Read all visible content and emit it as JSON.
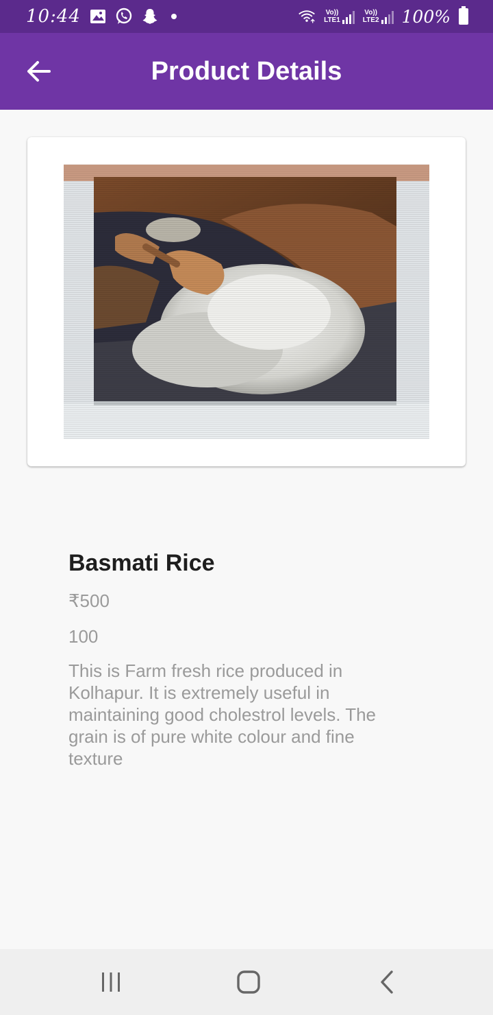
{
  "status_bar": {
    "time": "10:44",
    "sim1_top": "Vo))",
    "sim1_label": "LTE1",
    "sim2_top": "Vo))",
    "sim2_label": "LTE2",
    "battery": "100%",
    "icons": [
      "gallery-icon",
      "whatsapp-icon",
      "snapchat-icon",
      "notification-dot",
      "wifi-icon",
      "signal-icon",
      "battery-icon"
    ]
  },
  "app_bar": {
    "title": "Product Details",
    "back_icon": "arrow-left-icon"
  },
  "product": {
    "image_description_icon": "product-image",
    "name": "Basmati Rice",
    "price": "₹500",
    "quantity": "100",
    "description": "This is Farm fresh rice produced in Kolhapur. It is extremely useful in maintaining good cholestrol levels. The grain is of pure white colour and fine texture"
  },
  "nav_bar": {
    "icons": [
      "recents-icon",
      "home-icon",
      "back-icon"
    ]
  },
  "colors": {
    "status_bar": "#5b2a8c",
    "app_bar": "#6f35a5",
    "background": "#f8f8f8",
    "title_text": "#1e1e1e",
    "secondary_text": "#9a9a9a"
  }
}
